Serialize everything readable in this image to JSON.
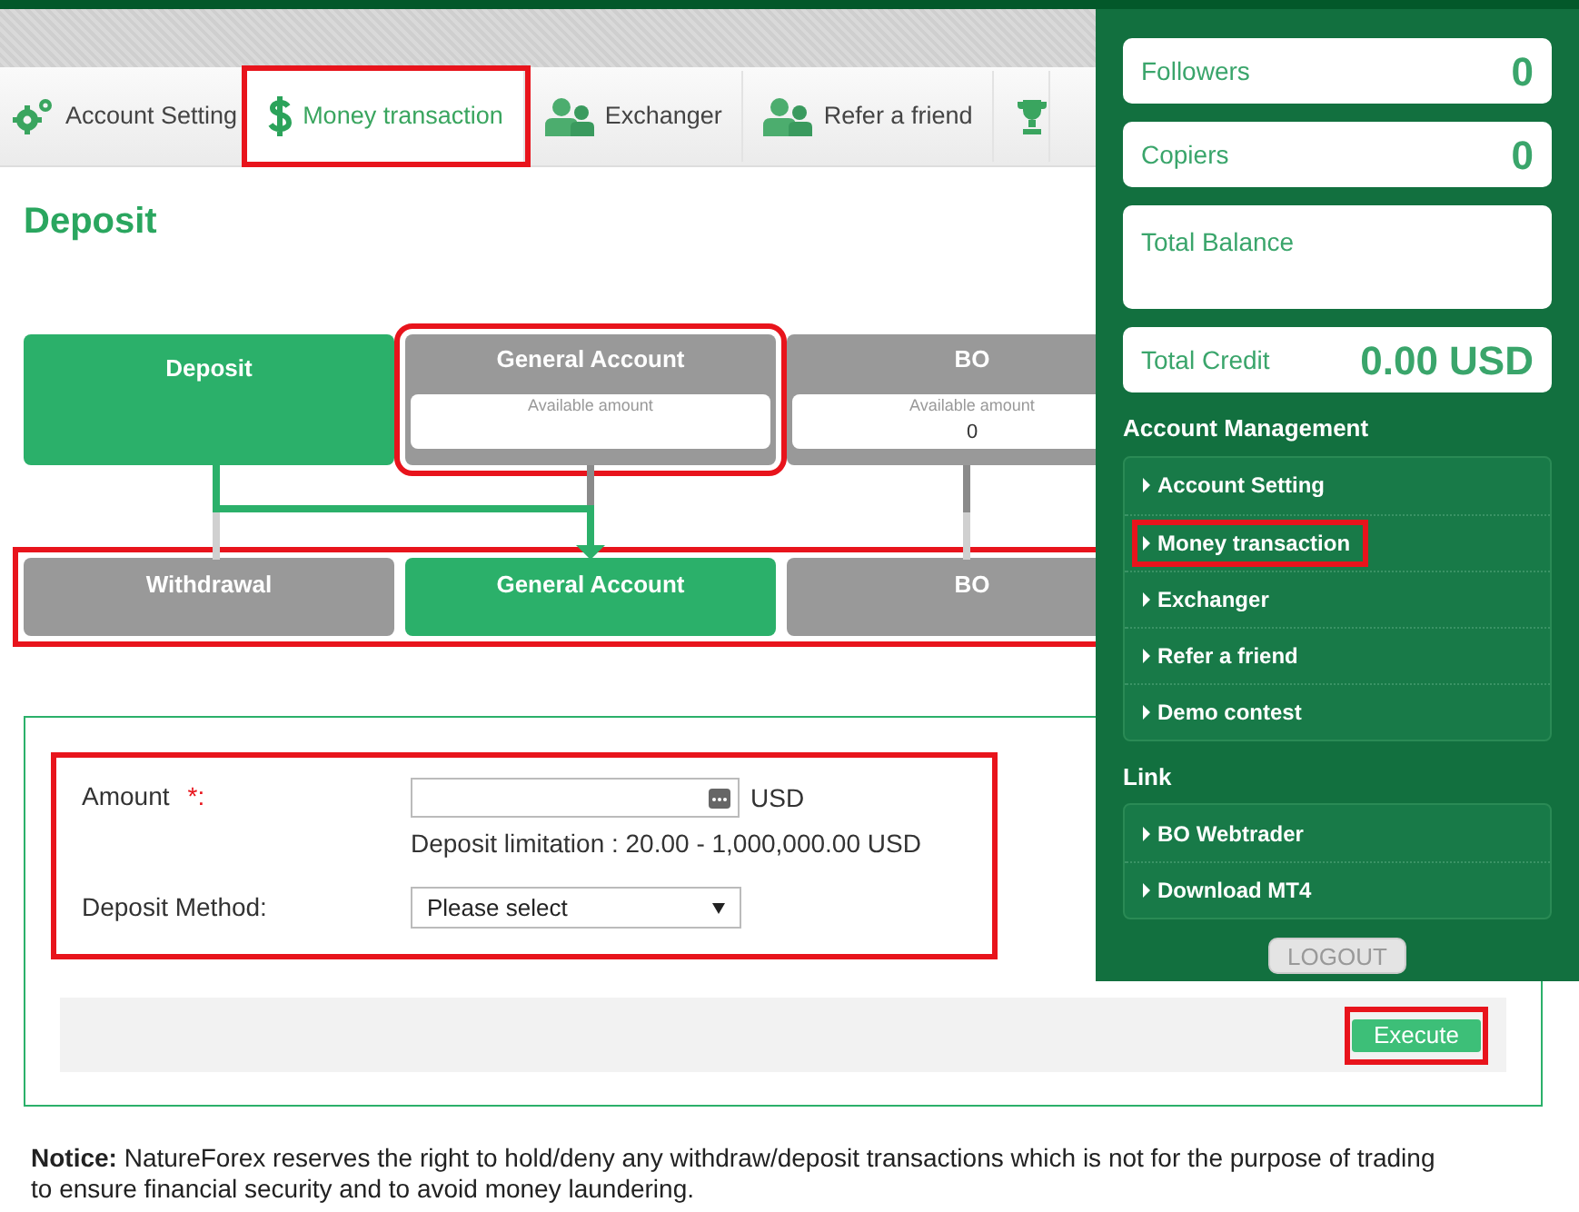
{
  "tabs": [
    {
      "label": "Account Setting",
      "selected": false,
      "highlighted": false
    },
    {
      "label": "Money transaction",
      "selected": true,
      "highlighted": true
    },
    {
      "label": "Exchanger",
      "selected": false,
      "highlighted": false
    },
    {
      "label": "Refer a friend",
      "selected": false,
      "highlighted": false
    },
    {
      "selected": false,
      "highlighted": false
    }
  ],
  "page_title": "Deposit",
  "flow": {
    "sources": [
      {
        "title": "Deposit",
        "selected": true,
        "highlighted": false
      },
      {
        "title": "General Account",
        "selected": false,
        "highlighted": true,
        "caption": "Available amount"
      },
      {
        "title": "BO",
        "selected": false,
        "highlighted": false,
        "caption": "Available amount",
        "amount": "0"
      }
    ],
    "targets_highlighted": true,
    "targets": [
      {
        "title": "Withdrawal",
        "selected": false
      },
      {
        "title": "General Account",
        "selected": true
      },
      {
        "title": "BO",
        "selected": false
      }
    ]
  },
  "form": {
    "highlighted": true,
    "amount_label": "Amount",
    "required_mark": "*:",
    "currency": "USD",
    "limitation": "Deposit limitation : 20.00 - 1,000,000.00 USD",
    "method_label": "Deposit Method:",
    "method_value": "Please select",
    "execute": "Execute",
    "execute_highlighted": true
  },
  "notice": "**Notice:**  NatureForex reserves the right to hold/deny any withdraw/deposit transactions which is not for the purpose of trading to ensure financial security and to avoid money laundering.",
  "panel": {
    "stats": [
      {
        "label": "Followers",
        "value": "0"
      },
      {
        "label": "Copiers",
        "value": "0"
      },
      {
        "label": "Total Balance"
      },
      {
        "label": "Total Credit",
        "value": "0.00 USD"
      }
    ],
    "menu_title": "Account Management",
    "menu": [
      {
        "label": "Account Setting",
        "highlighted": false
      },
      {
        "label": "Money transaction",
        "highlighted": true
      },
      {
        "label": "Exchanger",
        "highlighted": false
      },
      {
        "label": "Refer a friend",
        "highlighted": false
      },
      {
        "label": "Demo contest",
        "highlighted": false
      }
    ],
    "link_title": "Link",
    "links": [
      {
        "label": "BO Webtrader"
      },
      {
        "label": "Download MT4"
      }
    ],
    "logout": "LOGOUT"
  }
}
